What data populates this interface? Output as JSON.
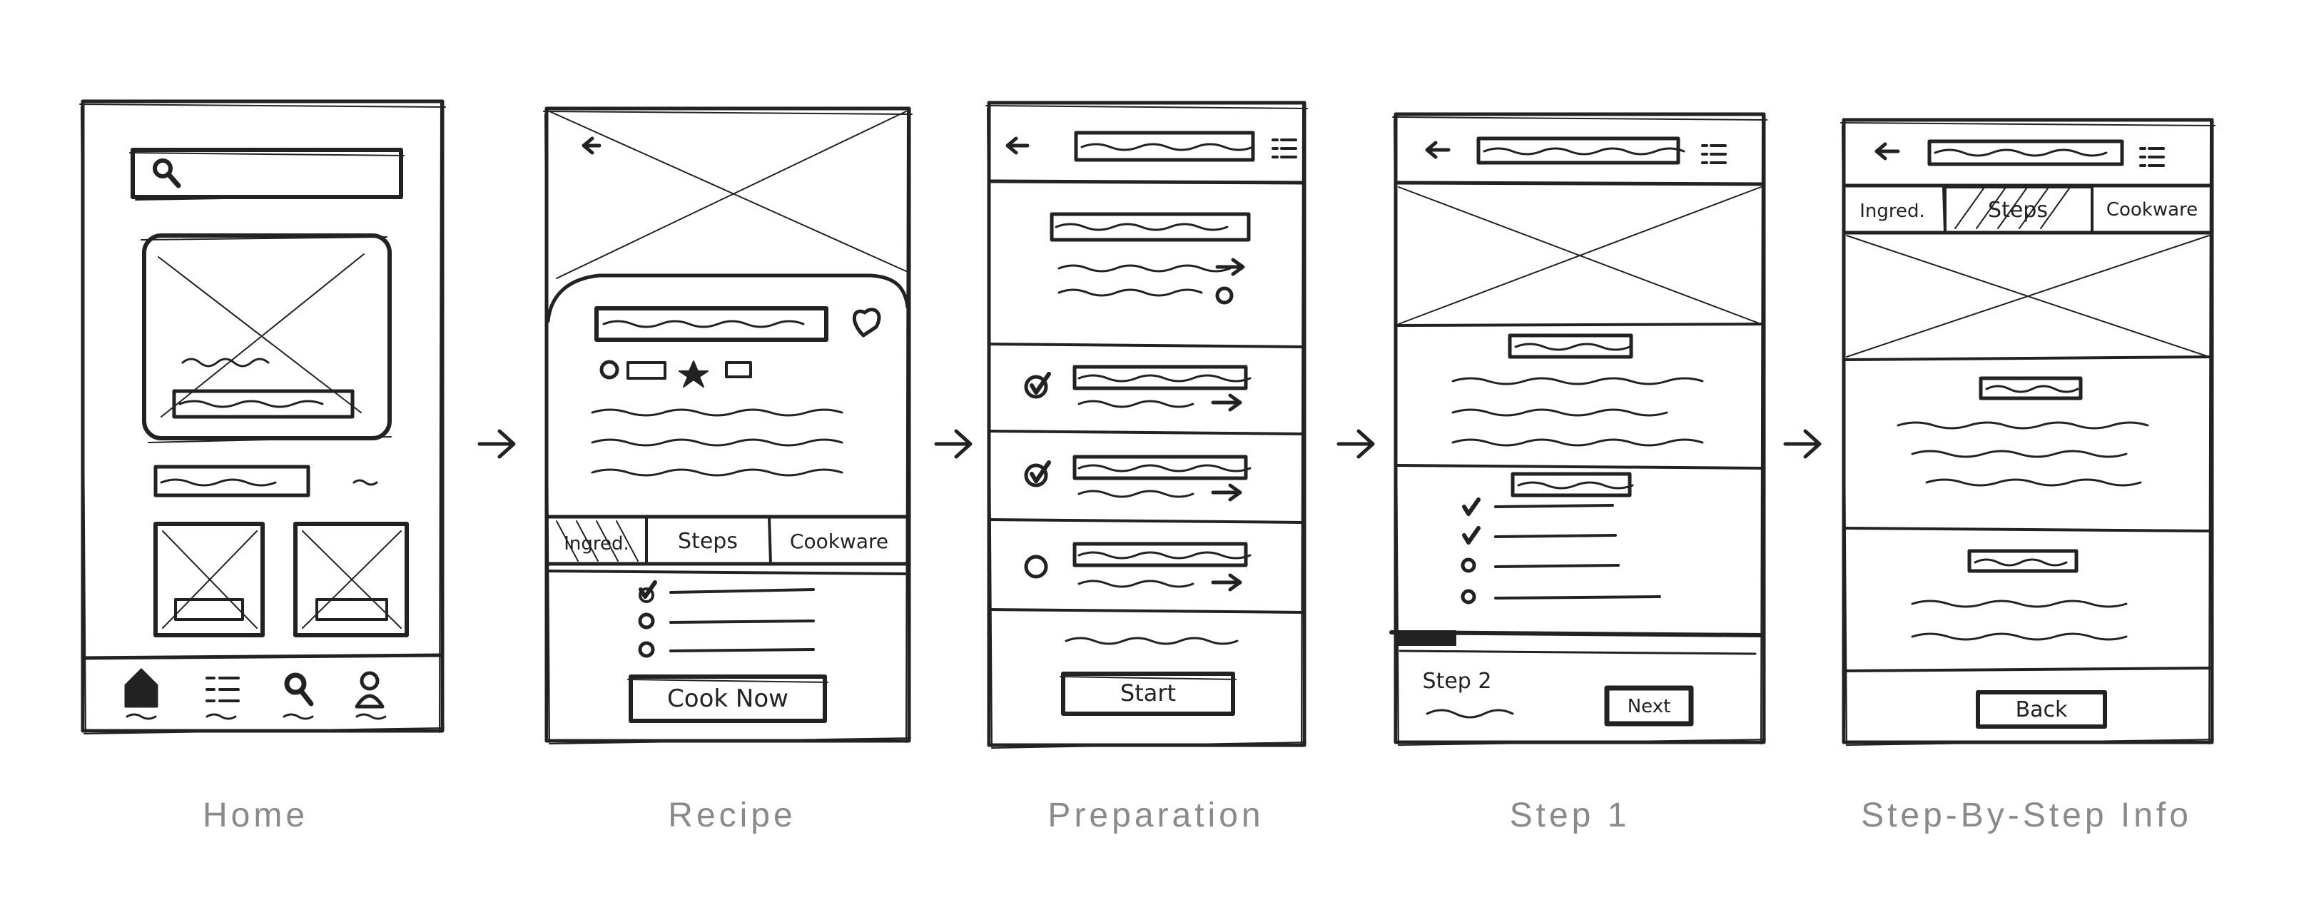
{
  "screens": [
    {
      "id": "home",
      "caption": "Home"
    },
    {
      "id": "recipe",
      "caption": "Recipe",
      "tabs": [
        "Ingred.",
        "Steps",
        "Cookware"
      ],
      "button": "Cook Now"
    },
    {
      "id": "preparation",
      "caption": "Preparation",
      "button": "Start"
    },
    {
      "id": "step1",
      "caption": "Step 1",
      "step_label": "Step 2",
      "button": "Next"
    },
    {
      "id": "step-by-step",
      "caption": "Step-By-Step Info",
      "tabs": [
        "Ingred.",
        "Steps",
        "Cookware"
      ],
      "button": "Back"
    }
  ],
  "flow_arrow_glyph": "→",
  "colors": {
    "ink": "#222222",
    "caption": "#8a8a8a",
    "background": "#ffffff"
  }
}
